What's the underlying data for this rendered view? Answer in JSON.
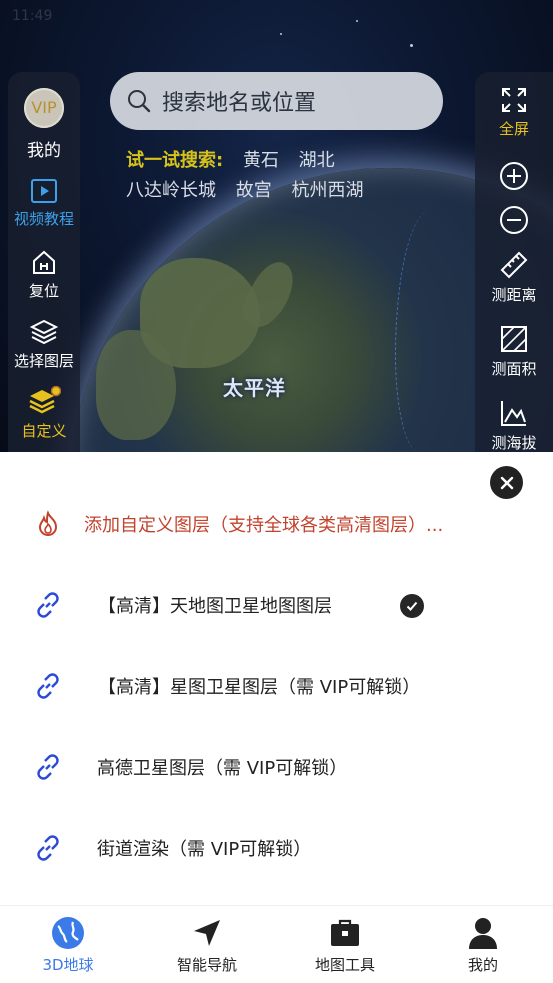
{
  "status_bar": {
    "time": "11:49"
  },
  "left_rail": {
    "avatar_text": "VIP",
    "my_label": "我的",
    "items": [
      {
        "icon": "video-icon",
        "label": "视频教程",
        "color": "#3da0e8"
      },
      {
        "icon": "home-icon",
        "label": "复位",
        "color": "#ffffff"
      },
      {
        "icon": "layers-icon",
        "label": "选择图层",
        "color": "#ffffff"
      },
      {
        "icon": "custom-layers-icon",
        "label": "自定义",
        "color": "#e8c21c"
      }
    ]
  },
  "right_rail": {
    "items": [
      {
        "icon": "fullscreen-icon",
        "label": "全屏",
        "color": "#e8c21c"
      },
      {
        "icon": "zoom-in-icon",
        "label": ""
      },
      {
        "icon": "zoom-out-icon",
        "label": ""
      },
      {
        "icon": "ruler-icon",
        "label": "测距离"
      },
      {
        "icon": "area-icon",
        "label": "测面积"
      },
      {
        "icon": "elevation-icon",
        "label": "测海拔"
      }
    ]
  },
  "search": {
    "placeholder": "搜索地名或位置",
    "try_label": "试一试搜索:",
    "suggestions_row1": [
      "黄石",
      "湖北"
    ],
    "suggestions_row2": [
      "八达岭长城",
      "故宫",
      "杭州西湖"
    ]
  },
  "map": {
    "ocean_label": "太平洋"
  },
  "sheet": {
    "add_layer_label": "添加自定义图层（支持全球各类高清图层）...",
    "layers": [
      {
        "label": "【高清】天地图卫星地图图层",
        "selected": true
      },
      {
        "label": "【高清】星图卫星图层（需 VIP可解锁）",
        "selected": false
      },
      {
        "label": "高德卫星图层（需 VIP可解锁）",
        "selected": false
      },
      {
        "label": "街道渲染（需 VIP可解锁）",
        "selected": false
      }
    ]
  },
  "tabbar": {
    "tabs": [
      {
        "icon": "globe-icon",
        "label": "3D地球",
        "active": true
      },
      {
        "icon": "navigation-icon",
        "label": "智能导航",
        "active": false
      },
      {
        "icon": "toolbox-icon",
        "label": "地图工具",
        "active": false
      },
      {
        "icon": "profile-icon",
        "label": "我的",
        "active": false
      }
    ]
  },
  "colors": {
    "accent": "#3b7be8",
    "warning": "#c2432d",
    "gold": "#e8c21c",
    "link_icon": "#2b4bd6"
  }
}
